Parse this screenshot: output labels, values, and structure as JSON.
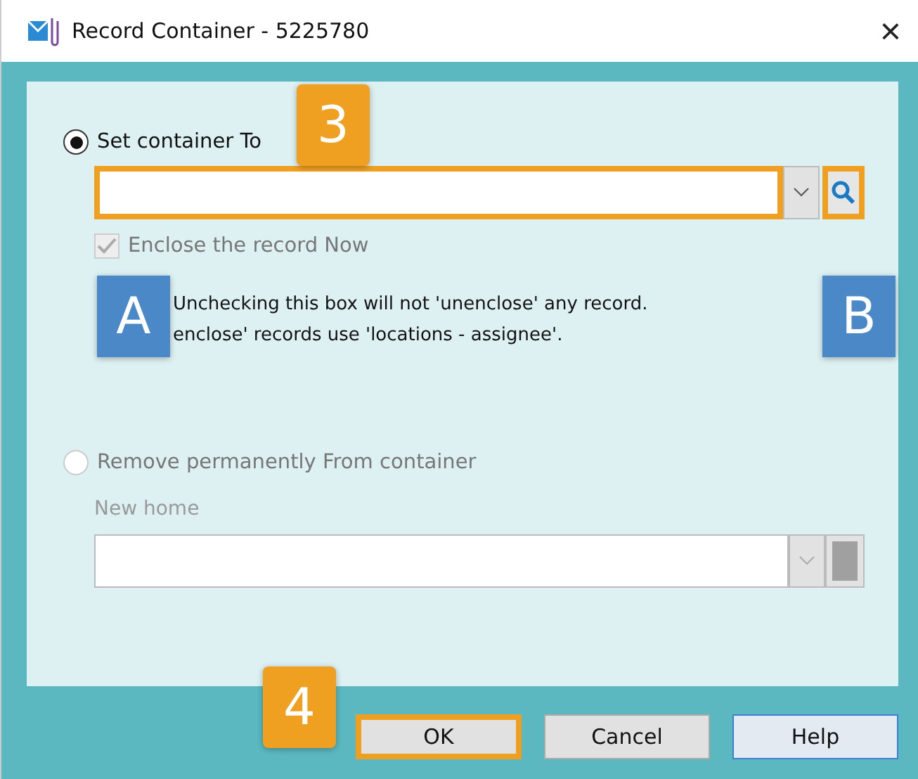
{
  "window": {
    "title": "Record Container - 5225780",
    "close": "×"
  },
  "options": [
    {
      "label": "Set container To",
      "selected": true,
      "disabled": false
    },
    {
      "label": "Remove permanently From container",
      "selected": false,
      "disabled": true
    }
  ],
  "container_field": {
    "highlighted": true
  },
  "enclose": {
    "label": "Enclose the record Now",
    "checked": true,
    "disabled": true
  },
  "note": [
    "Unchecking this box will not 'unenclose' any record.",
    "enclose' records use 'locations - assignee'."
  ],
  "new_home": {
    "label": "New home",
    "disabled": true
  },
  "callouts": [
    {
      "label": "3",
      "kind": "step"
    },
    {
      "label": "A",
      "kind": "letter"
    },
    {
      "label": "B",
      "kind": "letter"
    },
    {
      "label": "4",
      "kind": "step"
    }
  ],
  "buttons": [
    {
      "label": "OK",
      "highlighted": true,
      "kind": "default"
    },
    {
      "label": "Cancel",
      "highlighted": false,
      "kind": "plain"
    },
    {
      "label": "Help",
      "highlighted": false,
      "kind": "help"
    }
  ]
}
